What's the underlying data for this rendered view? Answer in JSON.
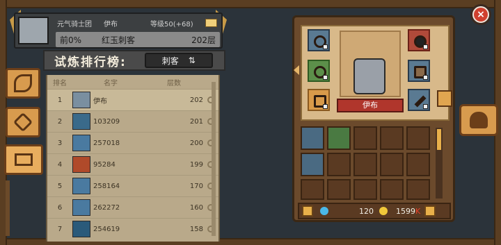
{
  "profile": {
    "guild": "元气骑士团",
    "name": "伊布",
    "level": "等级50(+68)",
    "percent": "前0%",
    "career": "红玉刺客",
    "floor": "202层"
  },
  "leaderboard": {
    "title": "试炼排行榜:",
    "class_button": "刺客",
    "swap_icon": "⇅",
    "headers": {
      "rank": "排名",
      "name": "名字",
      "floor": "层数"
    },
    "rows": [
      {
        "rank": "1",
        "name": "伊布",
        "floor": "202",
        "color": "#7a8fa0"
      },
      {
        "rank": "2",
        "name": "103209",
        "floor": "201",
        "color": "#3a6a8a"
      },
      {
        "rank": "3",
        "name": "257018",
        "floor": "200",
        "color": "#4a7aa0"
      },
      {
        "rank": "4",
        "name": "95284",
        "floor": "199",
        "color": "#b04a2a"
      },
      {
        "rank": "5",
        "name": "258164",
        "floor": "170",
        "color": "#4a7aa0"
      },
      {
        "rank": "6",
        "name": "262272",
        "floor": "160",
        "color": "#4a7aa0"
      },
      {
        "rank": "7",
        "name": "254619",
        "floor": "158",
        "color": "#2a5a7a"
      }
    ]
  },
  "equipment": {
    "hero_name": "伊布"
  },
  "currency": {
    "gems": "120",
    "coins": "1599",
    "coins_suffix": "K"
  },
  "icons": {
    "close": "×"
  }
}
